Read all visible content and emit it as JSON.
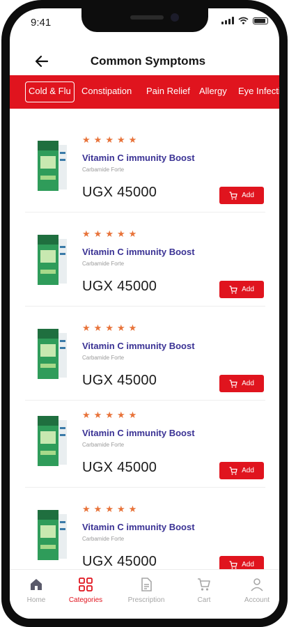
{
  "status_bar": {
    "time": "9:41"
  },
  "header": {
    "title": "Common Symptoms"
  },
  "categories": [
    {
      "label": "Cold & Flu",
      "active": true
    },
    {
      "label": "Constipation",
      "active": false
    },
    {
      "label": "Pain Relief",
      "active": false
    },
    {
      "label": "Allergy",
      "active": false
    },
    {
      "label": "Eye Infectio",
      "active": false
    }
  ],
  "products": [
    {
      "name": "Vitamin C immunity Boost",
      "subtitle": "Carbamide Forte",
      "price": "UGX 45000",
      "rating": 5,
      "add_label": "Add"
    },
    {
      "name": "Vitamin C immunity Boost",
      "subtitle": "Carbamide Forte",
      "price": "UGX 45000",
      "rating": 5,
      "add_label": "Add"
    },
    {
      "name": "Vitamin C immunity Boost",
      "subtitle": "Carbamide Forte",
      "price": "UGX 45000",
      "rating": 5,
      "add_label": "Add"
    },
    {
      "name": "Vitamin C immunity Boost",
      "subtitle": "Carbamide Forte",
      "price": "UGX 45000",
      "rating": 5,
      "add_label": "Add"
    },
    {
      "name": "Vitamin C immunity Boost",
      "subtitle": "Carbamide Forte",
      "price": "UGX 45000",
      "rating": 5,
      "add_label": "Add"
    }
  ],
  "bottom_nav": [
    {
      "label": "Home",
      "icon": "home-icon",
      "active": false
    },
    {
      "label": "Categories",
      "icon": "categories-icon",
      "active": true
    },
    {
      "label": "Prescription",
      "icon": "prescription-icon",
      "active": false
    },
    {
      "label": "Cart",
      "icon": "cart-icon",
      "active": false
    },
    {
      "label": "Account",
      "icon": "account-icon",
      "active": false
    }
  ],
  "colors": {
    "accent": "#e0141e",
    "product_name": "#3a3294",
    "star": "#e8733a"
  }
}
